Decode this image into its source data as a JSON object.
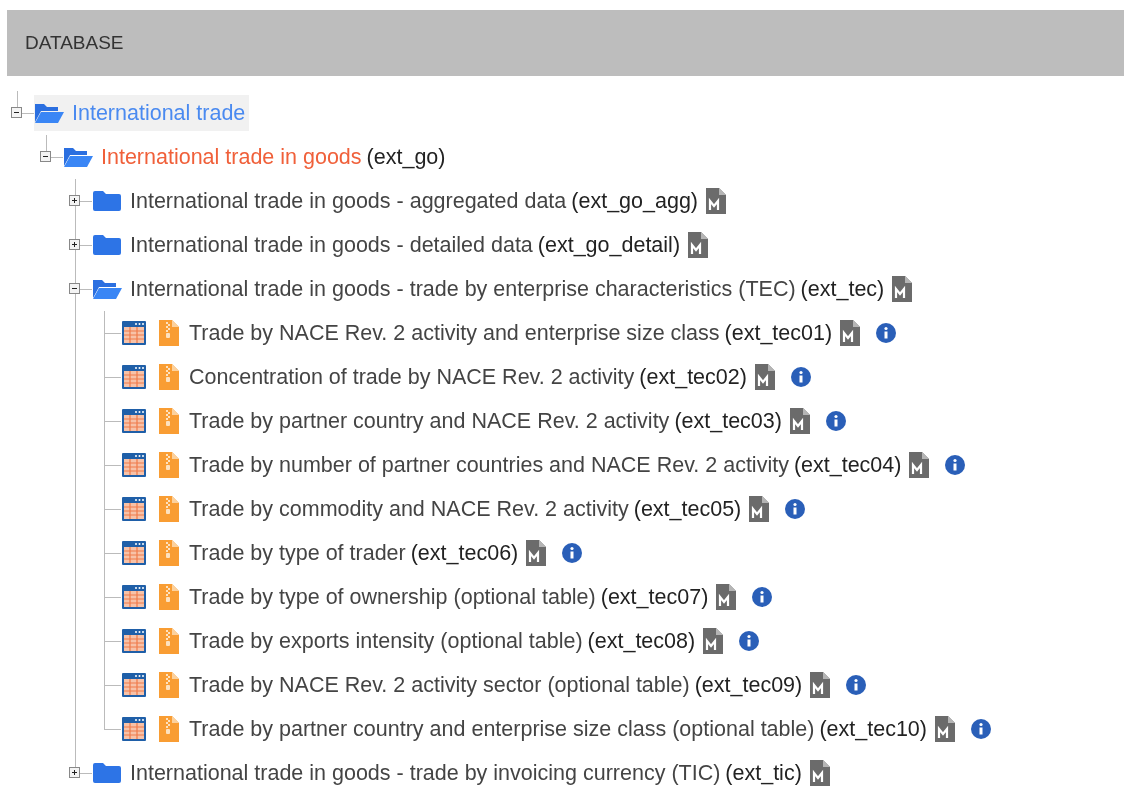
{
  "header": {
    "title": "DATABASE"
  },
  "tree": [
    {
      "kind": "folder",
      "label": "International trade",
      "expanded": true,
      "selected": true,
      "highlighted": false,
      "children": [
        {
          "kind": "folder",
          "label": "International trade in goods",
          "code": "(ext_go)",
          "expanded": true,
          "selected": false,
          "highlighted": true,
          "children": [
            {
              "kind": "folder",
              "label": "International trade in goods - aggregated data",
              "code": "(ext_go_agg)",
              "expanded": false,
              "selected": false,
              "highlighted": false,
              "metadata": true
            },
            {
              "kind": "folder",
              "label": "International trade in goods - detailed data",
              "code": "(ext_go_detail)",
              "expanded": false,
              "selected": false,
              "highlighted": false,
              "metadata": true
            },
            {
              "kind": "folder",
              "label": "International trade in goods - trade by enterprise characteristics (TEC)",
              "code": "(ext_tec)",
              "expanded": true,
              "selected": false,
              "highlighted": false,
              "metadata": true,
              "children": [
                {
                  "kind": "dataset",
                  "label": "Trade by NACE Rev. 2 activity and enterprise size class",
                  "code": "(ext_tec01)",
                  "selected": false,
                  "metadata": true,
                  "info": true
                },
                {
                  "kind": "dataset",
                  "label": "Concentration of trade by NACE Rev. 2 activity",
                  "code": "(ext_tec02)",
                  "selected": false,
                  "metadata": true,
                  "info": true
                },
                {
                  "kind": "dataset",
                  "label": "Trade by partner country and NACE Rev. 2 activity",
                  "code": "(ext_tec03)",
                  "selected": false,
                  "metadata": true,
                  "info": true
                },
                {
                  "kind": "dataset",
                  "label": "Trade by number of partner countries and NACE Rev. 2 activity",
                  "code": "(ext_tec04)",
                  "selected": false,
                  "metadata": true,
                  "info": true
                },
                {
                  "kind": "dataset",
                  "label": "Trade by commodity and NACE Rev. 2 activity",
                  "code": "(ext_tec05)",
                  "selected": false,
                  "metadata": true,
                  "info": true
                },
                {
                  "kind": "dataset",
                  "label": "Trade by type of trader",
                  "code": "(ext_tec06)",
                  "selected": false,
                  "metadata": true,
                  "info": true
                },
                {
                  "kind": "dataset",
                  "label": "Trade by type of ownership (optional table)",
                  "code": "(ext_tec07)",
                  "selected": false,
                  "metadata": true,
                  "info": true
                },
                {
                  "kind": "dataset",
                  "label": "Trade by exports intensity (optional table)",
                  "code": "(ext_tec08)",
                  "selected": false,
                  "metadata": true,
                  "info": true
                },
                {
                  "kind": "dataset",
                  "label": "Trade by NACE Rev. 2 activity sector (optional table)",
                  "code": "(ext_tec09)",
                  "selected": false,
                  "metadata": true,
                  "info": true
                },
                {
                  "kind": "dataset",
                  "label": "Trade by partner country and enterprise size class (optional table)",
                  "code": "(ext_tec10)",
                  "selected": false,
                  "metadata": true,
                  "info": true
                }
              ]
            },
            {
              "kind": "folder",
              "label": "International trade in goods - trade by invoicing currency (TIC)",
              "code": "(ext_tic)",
              "expanded": false,
              "selected": false,
              "highlighted": false,
              "metadata": true
            }
          ]
        }
      ]
    }
  ]
}
